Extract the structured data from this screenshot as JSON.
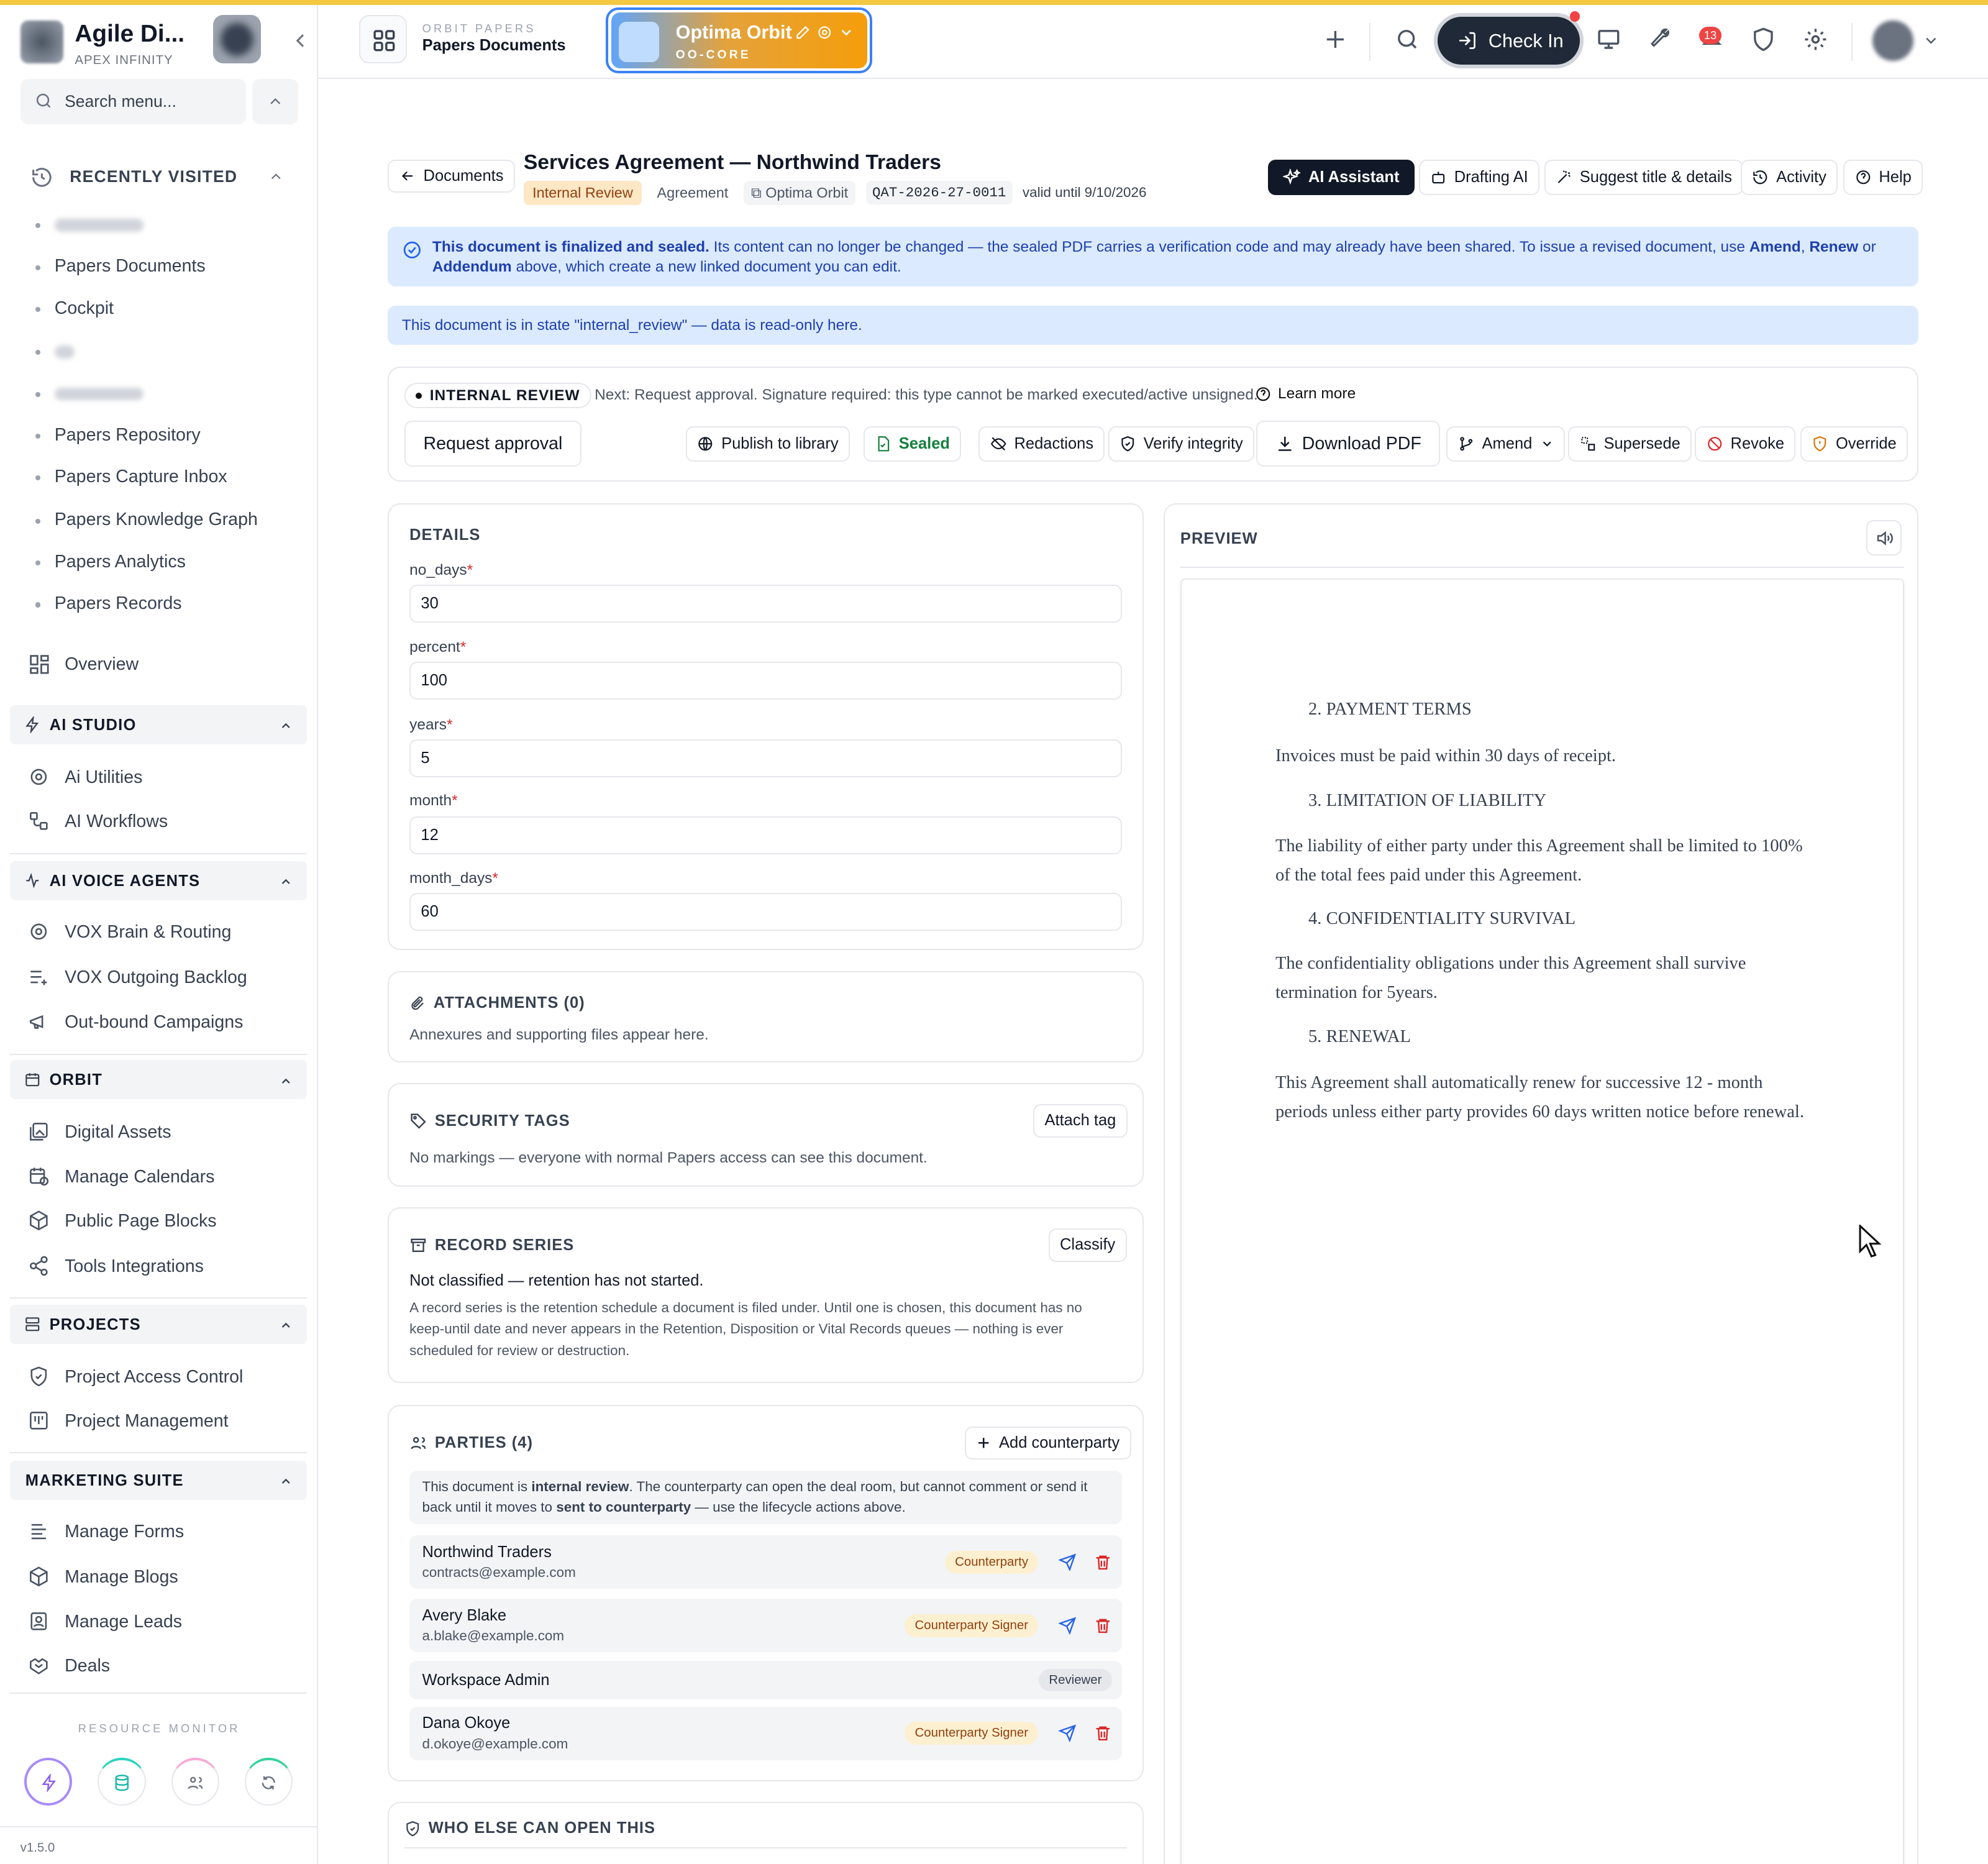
{
  "brand": {
    "name": "Agile Di...",
    "subtitle": "APEX INFINITY"
  },
  "search": {
    "placeholder": "Search menu..."
  },
  "recent": {
    "title": "RECENTLY VISITED",
    "items": [
      "Papers Documents",
      "Cockpit",
      "Papers Repository",
      "Papers Capture Inbox",
      "Papers Knowledge Graph",
      "Papers Analytics",
      "Papers Records"
    ]
  },
  "nav": {
    "overview": "Overview",
    "ai_studio": {
      "title": "AI STUDIO",
      "items": [
        "Ai Utilities",
        "AI Workflows"
      ]
    },
    "ai_voice": {
      "title": "AI VOICE AGENTS",
      "items": [
        "VOX Brain & Routing",
        "VOX Outgoing Backlog",
        "Out-bound Campaigns"
      ]
    },
    "orbit": {
      "title": "ORBIT",
      "items": [
        "Digital Assets",
        "Manage Calendars",
        "Public Page Blocks",
        "Tools Integrations"
      ]
    },
    "projects": {
      "title": "PROJECTS",
      "items": [
        "Project Access Control",
        "Project Management"
      ]
    },
    "marketing": {
      "title": "MARKETING SUITE",
      "items": [
        "Manage Forms",
        "Manage Blogs",
        "Manage Leads",
        "Deals"
      ]
    }
  },
  "resource": {
    "title": "RESOURCE MONITOR"
  },
  "version": "v1.5.0",
  "header": {
    "kicker": "ORBIT PAPERS",
    "title": "Papers Documents",
    "workspace_name": "Optima Orbit",
    "workspace_code": "OO-CORE",
    "check_in": "Check In",
    "notifications": "13"
  },
  "doc": {
    "back": "Documents",
    "title": "Services Agreement — Northwind Traders",
    "status": "Internal Review",
    "type": "Agreement",
    "workspace": "Optima Orbit",
    "code": "QAT-2026-27-0011",
    "valid": "valid until 9/10/2026",
    "actions": {
      "ai": "AI Assistant",
      "drafting": "Drafting AI",
      "suggest": "Suggest title & details",
      "activity": "Activity",
      "help": "Help"
    }
  },
  "alert_sealed": {
    "bold": "This document is finalized and sealed.",
    "text1": " Its content can no longer be changed — the sealed PDF carries a verification code and may already have been shared. To issue a revised document, use ",
    "amend": "Amend",
    "sep": ", ",
    "renew": "Renew",
    "or": " or",
    "addendum": "Addendum",
    "text2": " above, which create a new linked document you can edit."
  },
  "alert_state": "This document is in state \"internal_review\" — data is read-only here.",
  "lifecycle": {
    "state": "INTERNAL REVIEW",
    "next": "Next: Request approval. Signature required: this type cannot be marked executed/active unsigned.",
    "learn": "Learn more",
    "request": "Request approval",
    "publish": "Publish to library",
    "sealed": "Sealed",
    "redactions": "Redactions",
    "verify": "Verify integrity",
    "download": "Download PDF",
    "amend": "Amend",
    "supersede": "Supersede",
    "revoke": "Revoke",
    "override": "Override"
  },
  "details": {
    "title": "DETAILS",
    "fields": [
      {
        "label": "no_days",
        "value": "30"
      },
      {
        "label": "percent",
        "value": "100"
      },
      {
        "label": "years",
        "value": "5"
      },
      {
        "label": "month",
        "value": "12"
      },
      {
        "label": "month_days",
        "value": "60"
      }
    ]
  },
  "attachments": {
    "title": "ATTACHMENTS (0)",
    "text": "Annexures and supporting files appear here."
  },
  "security": {
    "title": "SECURITY TAGS",
    "button": "Attach tag",
    "text": "No markings — everyone with normal Papers access can see this document."
  },
  "records": {
    "title": "RECORD SERIES",
    "button": "Classify",
    "status": "Not classified — retention has not started.",
    "text": "A record series is the retention schedule a document is filed under. Until one is chosen, this document has no keep-until date and never appears in the Retention, Disposition or Vital Records queues — nothing is ever scheduled for review or destruction."
  },
  "parties": {
    "title": "PARTIES (4)",
    "button": "Add counterparty",
    "note_a": "This document is ",
    "note_b": "internal review",
    "note_c": ". The counterparty can open the deal room, but cannot comment or send it back until it moves to ",
    "note_d": "sent to counterparty",
    "note_e": " — use the lifecycle actions above.",
    "list": [
      {
        "name": "Northwind Traders",
        "email": "contracts@example.com",
        "role": "Counterparty"
      },
      {
        "name": "Avery Blake",
        "email": "a.blake@example.com",
        "role": "Counterparty Signer"
      },
      {
        "name": "Workspace Admin",
        "email": "",
        "role": "Reviewer"
      },
      {
        "name": "Dana Okoye",
        "email": "d.okoye@example.com",
        "role": "Counterparty Signer"
      }
    ]
  },
  "who_else": {
    "title": "WHO ELSE CAN OPEN THIS"
  },
  "preview": {
    "title": "PREVIEW",
    "sections": [
      {
        "heading": "2. PAYMENT TERMS",
        "body": "Invoices must be paid within 30 days of receipt."
      },
      {
        "heading": "3. LIMITATION OF LIABILITY",
        "body": "The liability of either party under this Agreement shall be limited to 100% of the total fees paid under this Agreement."
      },
      {
        "heading": "4. CONFIDENTIALITY SURVIVAL",
        "body": "The confidentiality obligations under this Agreement shall survive termination for 5years."
      },
      {
        "heading": "5. RENEWAL",
        "body": "This Agreement shall automatically renew for successive 12 - month periods unless either party provides 60 days written notice before renewal."
      }
    ]
  }
}
